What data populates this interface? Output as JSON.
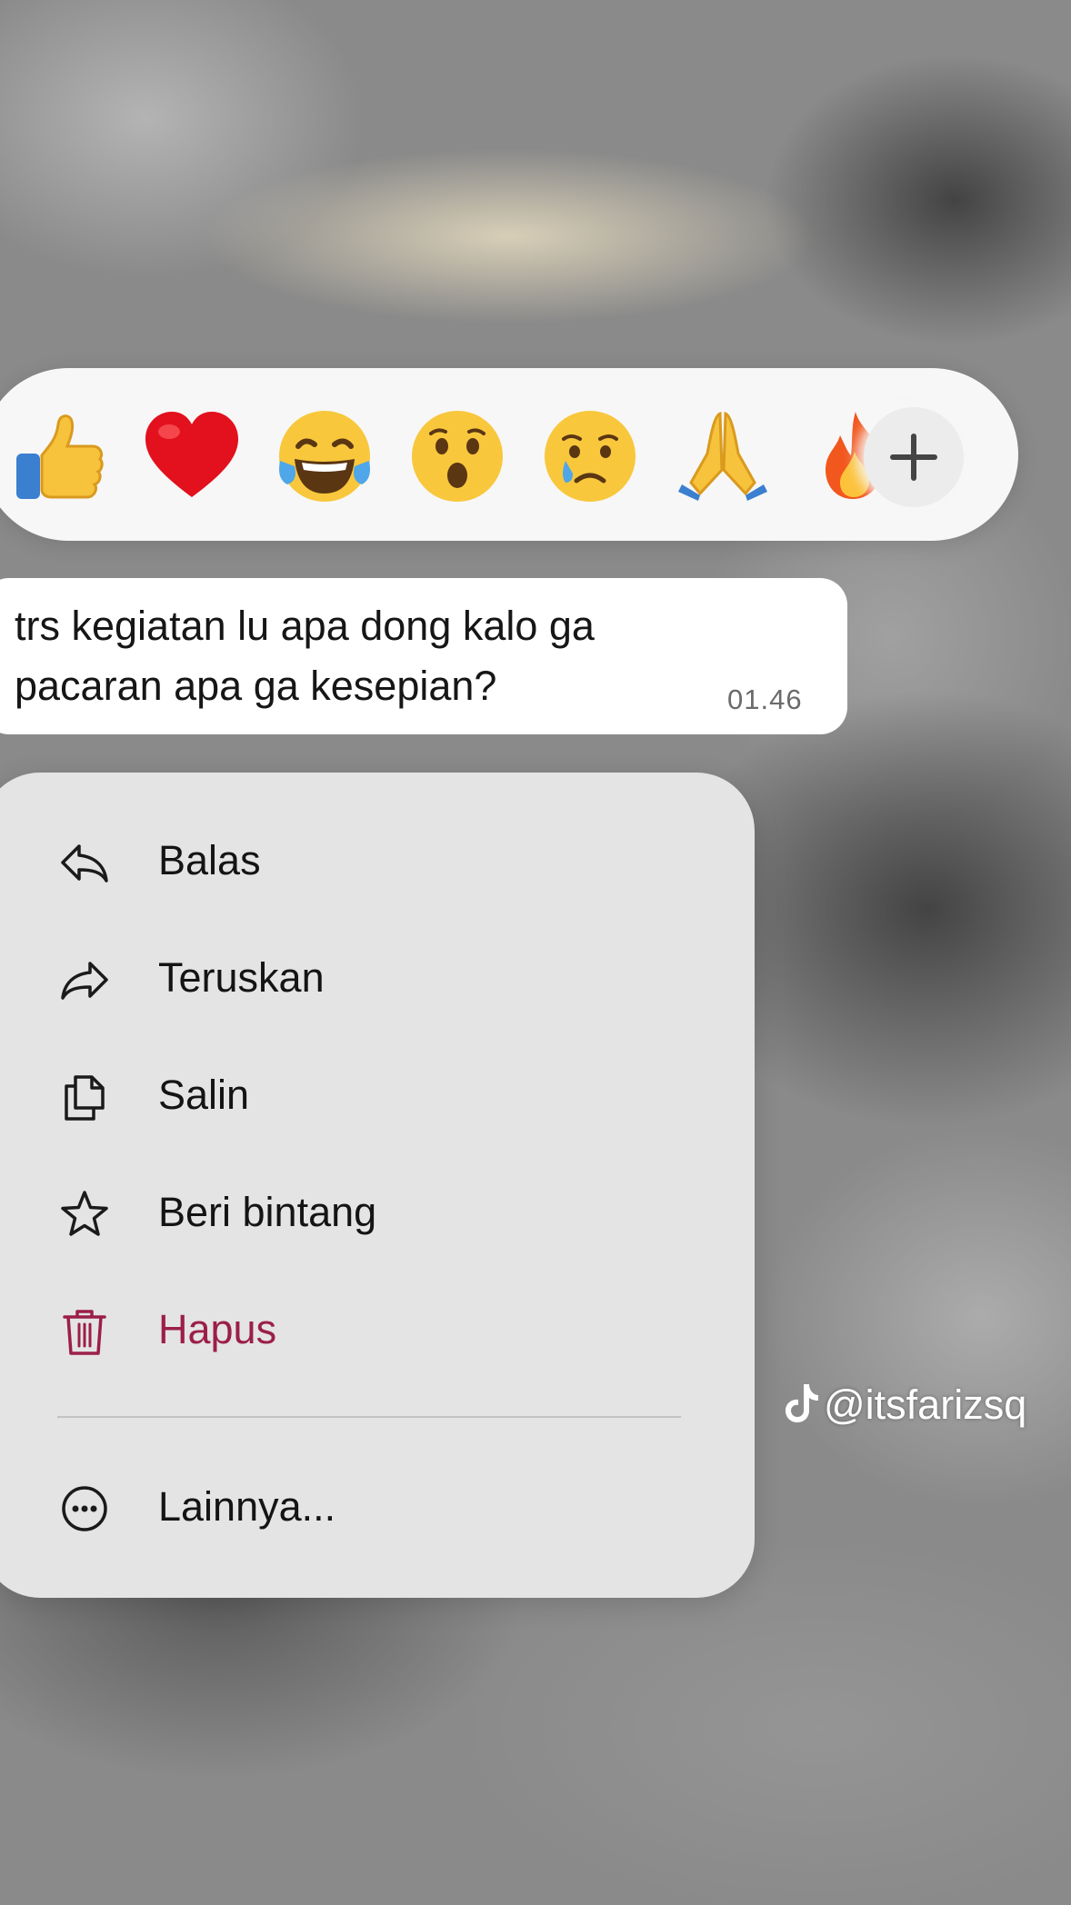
{
  "reactions": {
    "emojis": [
      "thumbs-up",
      "red-heart",
      "tears-of-joy",
      "surprised-face",
      "crying-face",
      "folded-hands",
      "fire"
    ],
    "add_icon": "plus-icon"
  },
  "message": {
    "text": "trs kegiatan lu apa dong kalo ga pacaran apa ga kesepian?",
    "time": "01.46"
  },
  "menu": {
    "items": [
      {
        "label": "Balas",
        "icon": "reply-icon"
      },
      {
        "label": "Teruskan",
        "icon": "forward-icon"
      },
      {
        "label": "Salin",
        "icon": "copy-icon"
      },
      {
        "label": "Beri bintang",
        "icon": "star-icon"
      },
      {
        "label": "Hapus",
        "icon": "trash-icon",
        "color": "#9b1f48"
      }
    ],
    "more": {
      "label": "Lainnya...",
      "icon": "more-icon"
    }
  },
  "watermark": {
    "text": "@itsfarizsq",
    "icon": "tiktok-icon"
  }
}
